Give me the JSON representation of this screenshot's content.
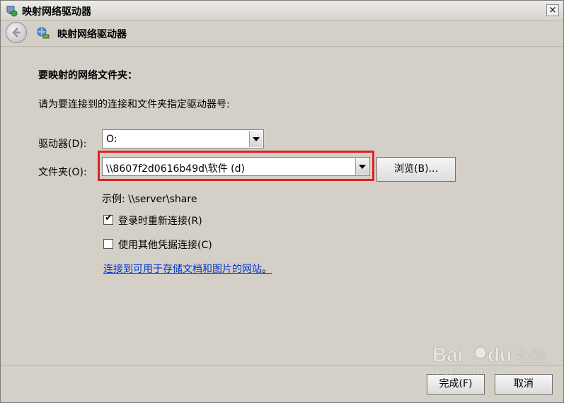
{
  "window": {
    "title": "映射网络驱动器",
    "close_label": "×"
  },
  "nav": {
    "title": "映射网络驱动器",
    "back_icon": "back-arrow-icon",
    "network_icon": "network-drive-icon"
  },
  "main": {
    "heading": "要映射的网络文件夹：",
    "instruction": "请为要连接到的连接和文件夹指定驱动器号:",
    "drive_label": "驱动器(D):",
    "drive_value": "O:",
    "folder_label": "文件夹(O):",
    "folder_value": "\\\\8607f2d0616b49d\\软件 (d)",
    "browse_label": "浏览(B)...",
    "example_text": "示例: \\\\server\\share",
    "reconnect_label": "登录时重新连接(R)",
    "reconnect_checked": true,
    "credentials_label": "使用其他凭据连接(C)",
    "credentials_checked": false,
    "link_text": "连接到可用于存储文档和图片的网站",
    "link_suffix": "。"
  },
  "footer": {
    "finish_label": "完成(F)",
    "cancel_label": "取消"
  },
  "watermark": {
    "text": "Baidu 经验",
    "subtext": "jingyan.baidu.com"
  },
  "colors": {
    "highlight": "#e02020",
    "link": "#0033cc",
    "background": "#d4d0c8"
  }
}
